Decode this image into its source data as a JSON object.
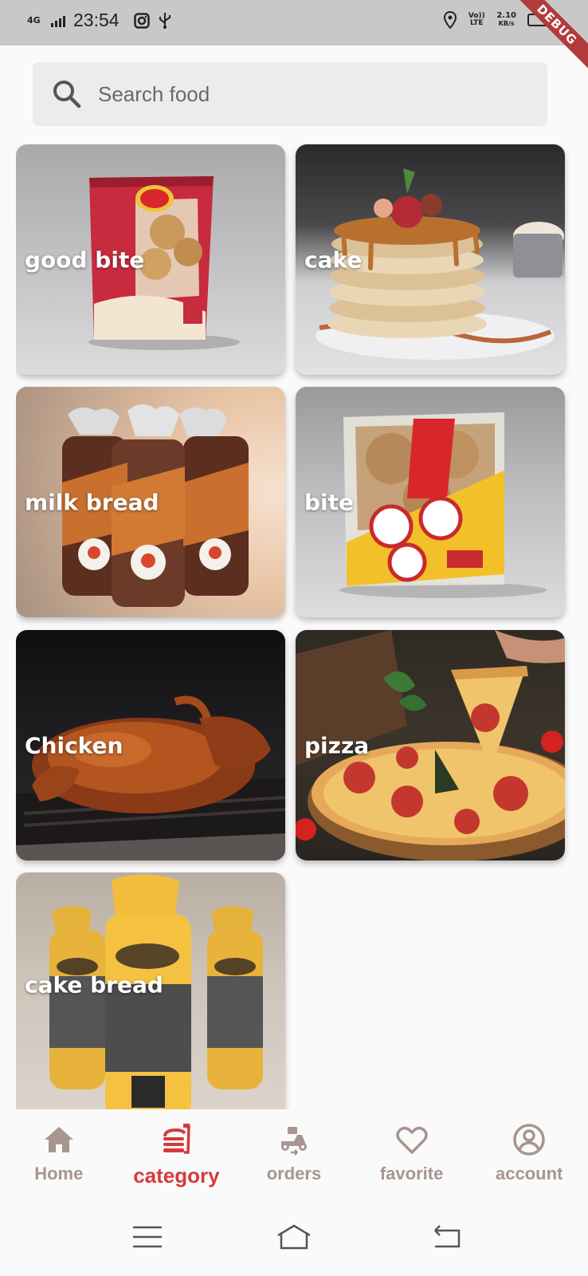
{
  "status_bar": {
    "network": "4G",
    "time": "23:54",
    "volte": "Vo)) LTE",
    "speed_value": "2.10",
    "speed_unit": "KB/s",
    "debug_label": "DEBUG"
  },
  "search": {
    "placeholder": "Search food"
  },
  "categories": [
    {
      "label": "good bite"
    },
    {
      "label": "cake"
    },
    {
      "label": "milk bread"
    },
    {
      "label": "bite"
    },
    {
      "label": "Chicken"
    },
    {
      "label": "pizza"
    },
    {
      "label": "cake bread"
    }
  ],
  "bottom_nav": {
    "items": [
      {
        "label": "Home",
        "icon": "home-icon"
      },
      {
        "label": "category",
        "icon": "category-icon",
        "active": true
      },
      {
        "label": "orders",
        "icon": "delivery-scooter-icon"
      },
      {
        "label": "favorite",
        "icon": "heart-icon"
      },
      {
        "label": "account",
        "icon": "account-circle-icon"
      }
    ]
  },
  "colors": {
    "accent": "#d63a3a",
    "inactive": "#a89590",
    "search_bg": "#ececec",
    "status_bar_bg": "#c8c8c8"
  }
}
